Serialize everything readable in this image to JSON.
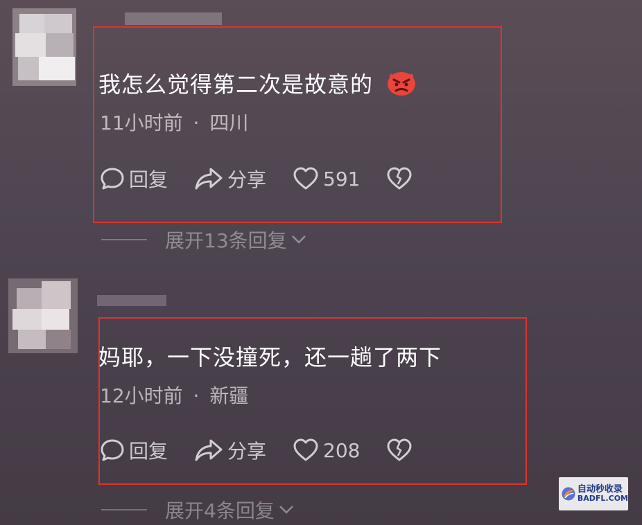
{
  "comments": [
    {
      "text": "我怎么觉得第二次是故意的",
      "emoji": "angry-face-emoji",
      "time": "11小时前",
      "separator": "·",
      "location": "四川",
      "reply_label": "回复",
      "share_label": "分享",
      "likes": "591",
      "expand_label": "展开13条回复"
    },
    {
      "text": "妈耶，一下没撞死，还一趟了两下",
      "time": "12小时前",
      "separator": "·",
      "location": "新疆",
      "reply_label": "回复",
      "share_label": "分享",
      "likes": "208",
      "expand_label": "展开4条回复"
    }
  ],
  "highlight_color": "#e0322f",
  "watermark": {
    "text_cn": "自动秒收录",
    "text_en": "BADFL.COM"
  }
}
